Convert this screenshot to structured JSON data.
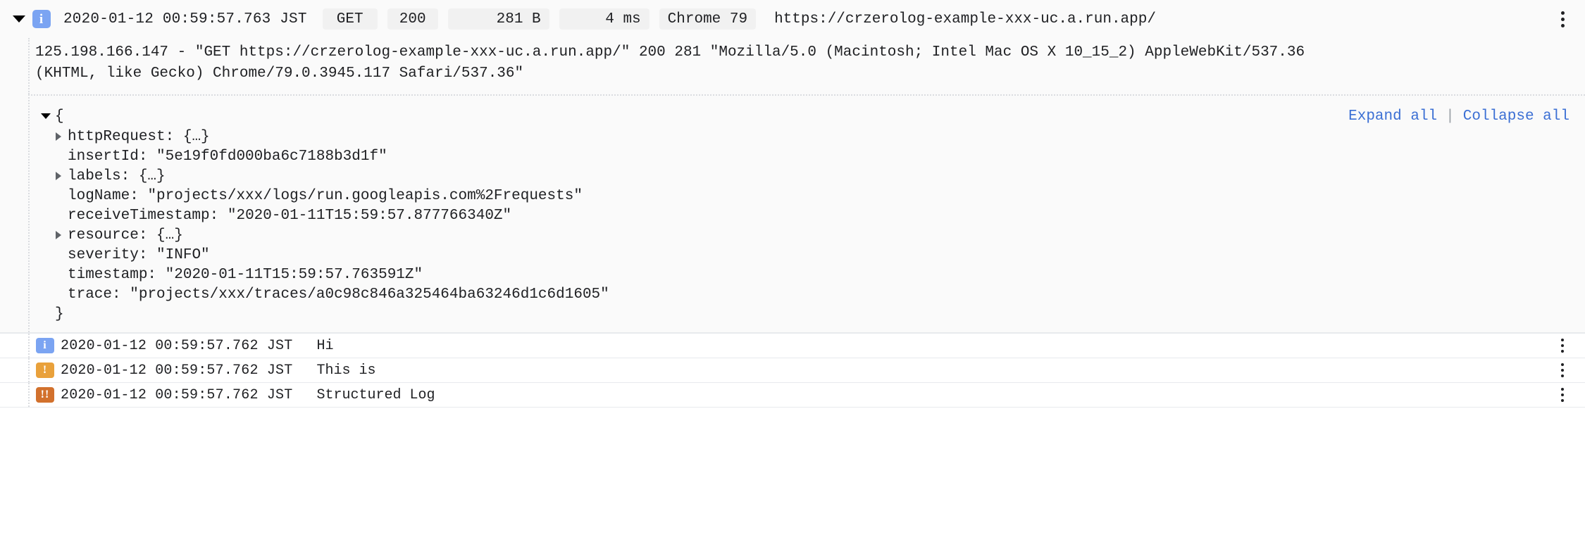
{
  "entry": {
    "disclosure_icon": "triangle-down-icon",
    "severity_icon": "info-severity-icon",
    "severity": "INFO",
    "timestamp": "2020-01-12 00:59:57.763 JST",
    "chips": {
      "method": "GET",
      "status": "200",
      "size": "281 B",
      "latency": "4 ms",
      "user_agent": "Chrome 79"
    },
    "url": "https://crzerolog-example-xxx-uc.a.run.app/",
    "menu_icon": "kebab-menu-icon",
    "raw_lines": [
      "125.198.166.147 - \"GET https://crzerolog-example-xxx-uc.a.run.app/\" 200 281 \"Mozilla/5.0 (Macintosh; Intel Mac OS X 10_15_2) AppleWebKit/537.36",
      "(KHTML, like Gecko) Chrome/79.0.3945.117 Safari/537.36\""
    ]
  },
  "json_tree": {
    "open_brace": "{",
    "close_brace": "}",
    "expand_all_label": "Expand all",
    "separator": "|",
    "collapse_all_label": "Collapse all",
    "fields": [
      {
        "key": "httpRequest:",
        "value": "{…}",
        "expandable": true
      },
      {
        "key": "insertId:",
        "value": "\"5e19f0fd000ba6c7188b3d1f\"",
        "expandable": false
      },
      {
        "key": "labels:",
        "value": "{…}",
        "expandable": true
      },
      {
        "key": "logName:",
        "value": "\"projects/xxx/logs/run.googleapis.com%2Frequests\"",
        "expandable": false
      },
      {
        "key": "receiveTimestamp:",
        "value": "\"2020-01-11T15:59:57.877766340Z\"",
        "expandable": false
      },
      {
        "key": "resource:",
        "value": "{…}",
        "expandable": true
      },
      {
        "key": "severity:",
        "value": "\"INFO\"",
        "expandable": false
      },
      {
        "key": "timestamp:",
        "value": "\"2020-01-11T15:59:57.763591Z\"",
        "expandable": false
      },
      {
        "key": "trace:",
        "value": "\"projects/xxx/traces/a0c98c846a325464ba63246d1c6d1605\"",
        "expandable": false
      }
    ]
  },
  "rows": [
    {
      "severity": "INFO",
      "severity_icon": "info-severity-icon",
      "severity_glyph": "i",
      "timestamp": "2020-01-12 00:59:57.762 JST",
      "message": "Hi",
      "menu_icon": "kebab-menu-icon"
    },
    {
      "severity": "WARNING",
      "severity_icon": "warning-severity-icon",
      "severity_glyph": "!",
      "timestamp": "2020-01-12 00:59:57.762 JST",
      "message": "This is",
      "menu_icon": "kebab-menu-icon"
    },
    {
      "severity": "ERROR",
      "severity_icon": "error-severity-icon",
      "severity_glyph": "!!",
      "timestamp": "2020-01-12 00:59:57.762 JST",
      "message": "Structured Log",
      "menu_icon": "kebab-menu-icon"
    }
  ],
  "colors": {
    "info": "#7ba4f2",
    "warning": "#e9a13b",
    "error": "#d2712d",
    "link": "#3b6fd4",
    "chip_bg": "#f1f1f1",
    "panel_bg": "#fafafa"
  }
}
